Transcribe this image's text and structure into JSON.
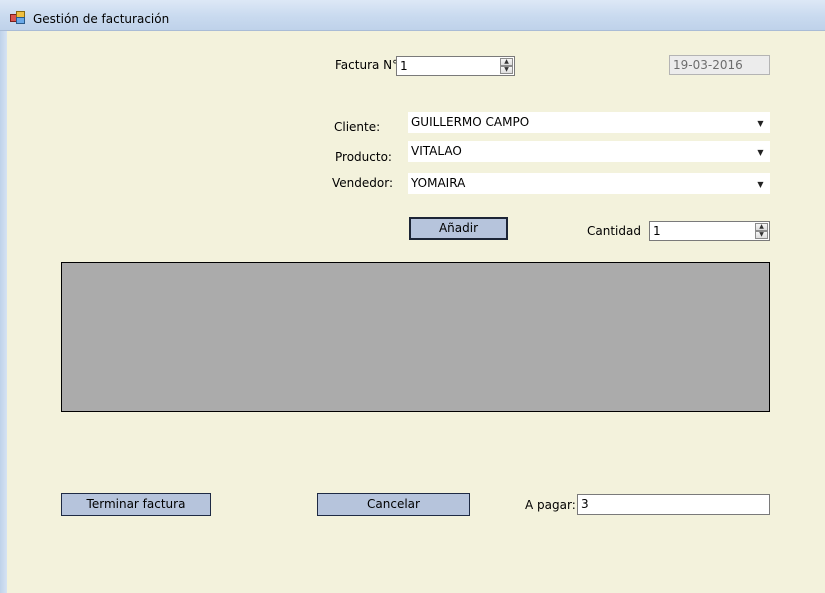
{
  "window": {
    "title": "Gestión de facturación"
  },
  "icons": {
    "app": "app-form-icon",
    "spin_up": "spin-up-icon",
    "spin_down": "spin-down-icon",
    "dropdown": "dropdown-arrow-icon"
  },
  "invoice": {
    "number_label": "Factura N°",
    "number_value": "1",
    "date_value": "19-03-2016"
  },
  "form": {
    "client_label": "Cliente:",
    "client_value": "GUILLERMO CAMPO",
    "product_label": "Producto:",
    "product_value": "VITALAO",
    "seller_label": "Vendedor:",
    "seller_value": "YOMAIRA"
  },
  "add": {
    "button_label": "Añadir",
    "quantity_label": "Cantidad",
    "quantity_value": "1"
  },
  "footer": {
    "finish_label": "Terminar factura",
    "cancel_label": "Cancelar",
    "pay_label": "A pagar:",
    "pay_value": "3"
  },
  "colors": {
    "form_bg": "#f3f2dc",
    "button_bg": "#b6c4dc",
    "grid_bg": "#ababab"
  }
}
